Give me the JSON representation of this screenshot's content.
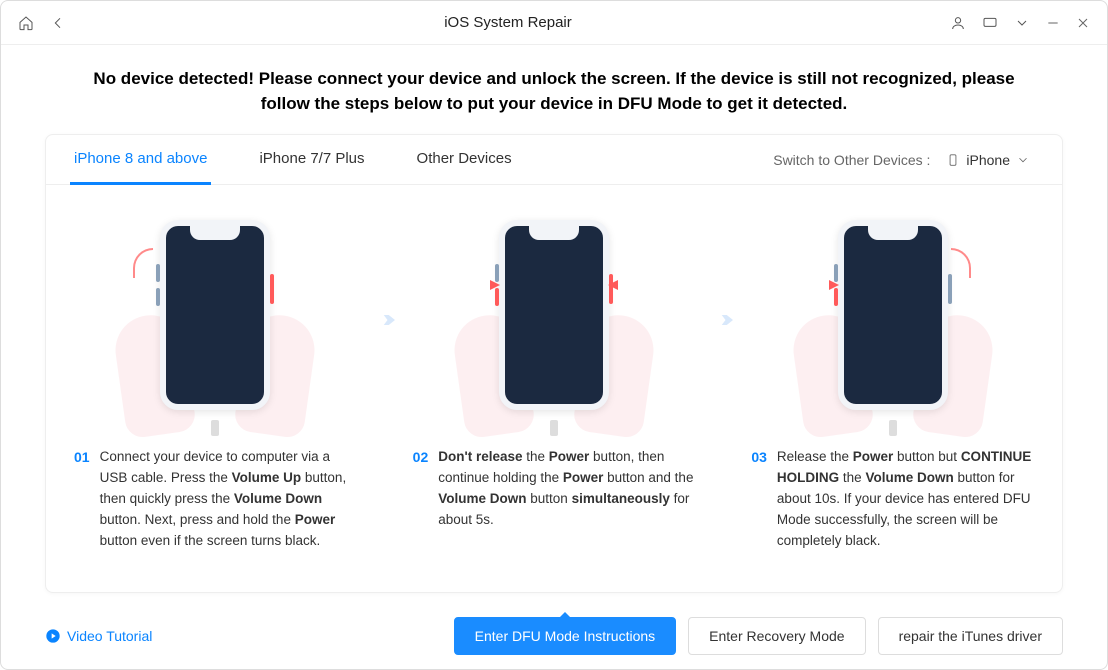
{
  "title": "iOS System Repair",
  "instruction": "No device detected! Please connect your device and unlock the screen. If the device is still not recognized, please follow the steps below to put your device in DFU Mode to get it detected.",
  "tabs": {
    "t1": "iPhone 8 and above",
    "t2": "iPhone 7/7 Plus",
    "t3": "Other Devices"
  },
  "switch_label": "Switch to Other Devices :",
  "device_selected": "iPhone",
  "steps": {
    "s1": {
      "num": "01",
      "html": "Connect your device to computer via a USB cable. Press the <b>Volume Up</b> button, then quickly press the <b>Volume Down</b> button. Next, press and hold the <b>Power</b> button even if the screen turns black."
    },
    "s2": {
      "num": "02",
      "html": "<b>Don't release</b> the <b>Power</b> button, then continue holding the <b>Power</b> button and the <b>Volume Down</b> button <b>simultaneously</b> for about 5s."
    },
    "s3": {
      "num": "03",
      "html": "Release the <b>Power</b> button but <b>CONTINUE HOLDING</b> the <b>Volume Down</b> button for about 10s. If your device has entered DFU Mode successfully, the screen will be completely black."
    }
  },
  "footer": {
    "video": "Video Tutorial",
    "b1": "Enter DFU Mode Instructions",
    "b2": "Enter Recovery Mode",
    "b3": "repair the iTunes driver"
  }
}
